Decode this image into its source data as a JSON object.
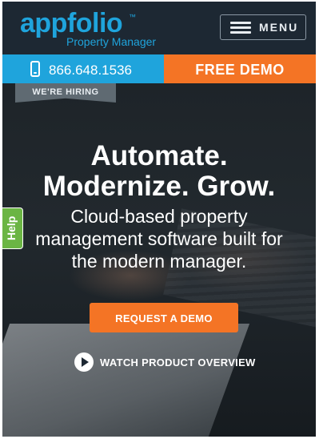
{
  "header": {
    "logo_main": "appfolio",
    "logo_tm": "™",
    "logo_sub": "Property Manager",
    "menu_label": "MENU"
  },
  "action_bar": {
    "phone_number": "866.648.1536",
    "demo_label": "FREE DEMO"
  },
  "hero": {
    "hiring_label": "WE'RE HIRING",
    "headline_line1": "Automate.",
    "headline_line2": "Modernize. Grow.",
    "subhead_line1": "Cloud-based property",
    "subhead_line2": "management software built for",
    "subhead_line3": "the modern manager.",
    "request_label": "REQUEST A DEMO",
    "watch_label": "WATCH PRODUCT OVERVIEW"
  },
  "help_label": "Help",
  "colors": {
    "brand_blue": "#1fa4dc",
    "brand_orange": "#f47425",
    "help_green": "#6bb544",
    "header_bg": "#1d2833"
  },
  "icons": [
    "hamburger-icon",
    "phone-icon",
    "play-icon"
  ]
}
